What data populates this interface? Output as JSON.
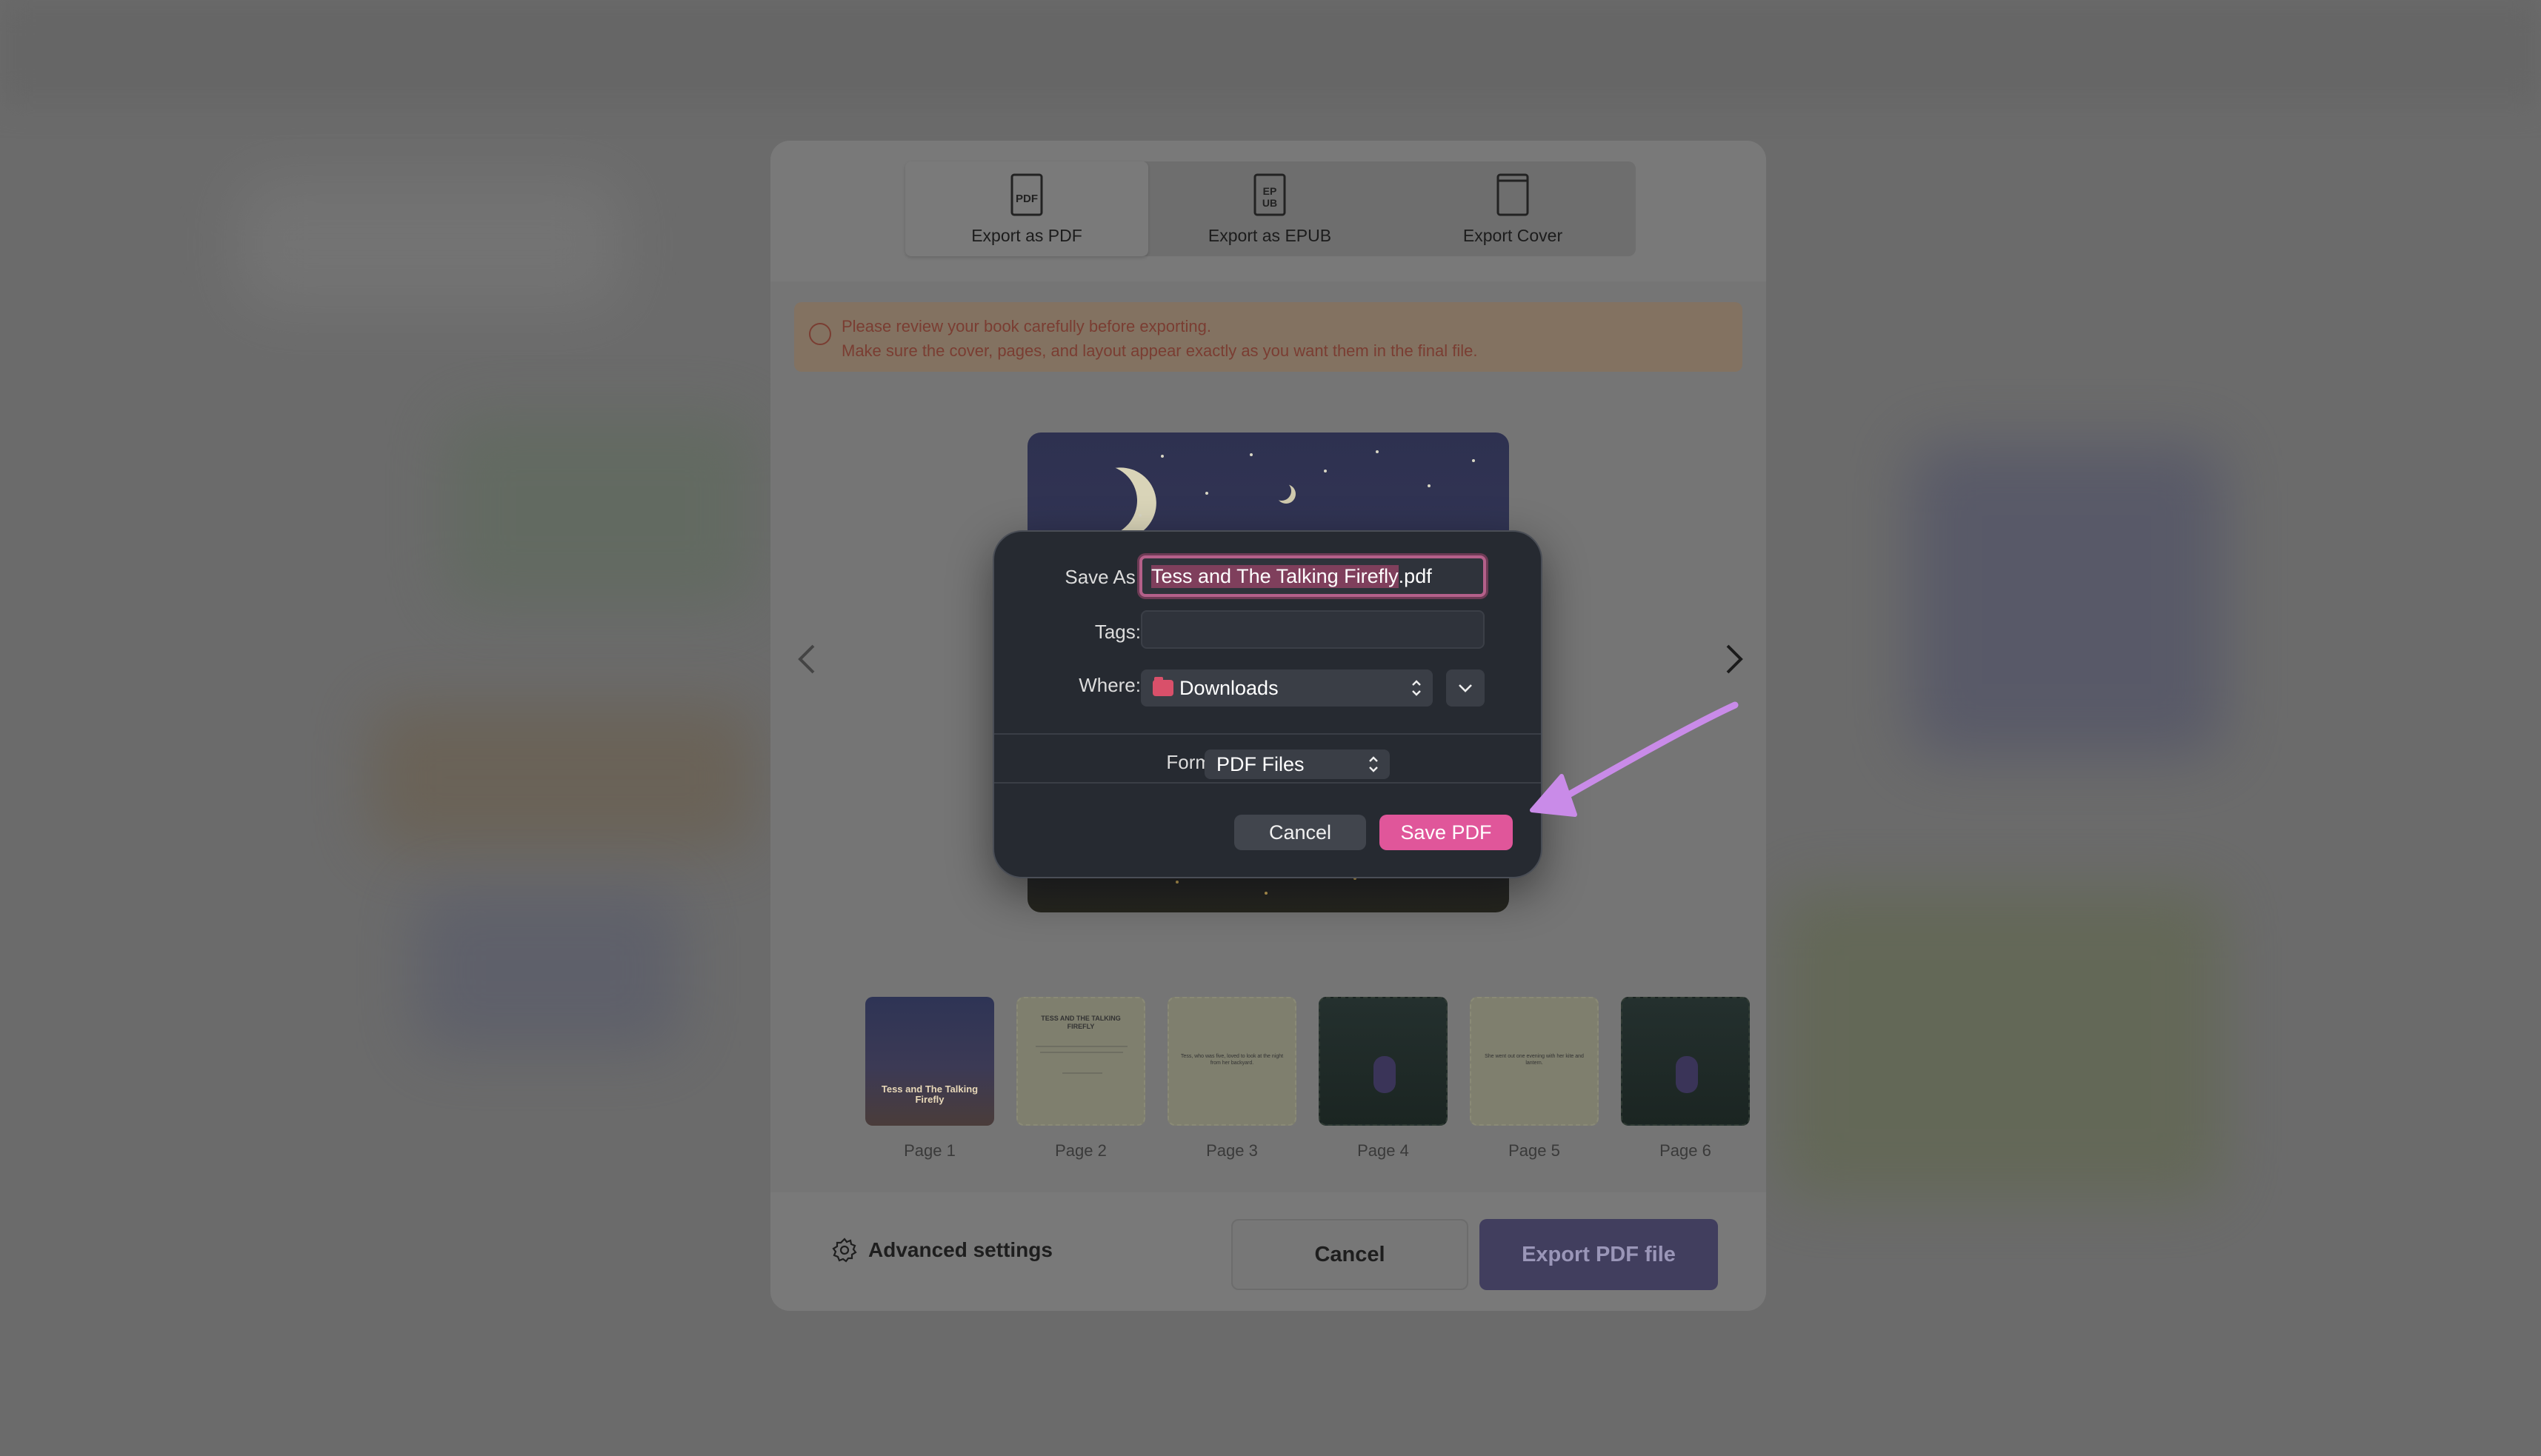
{
  "export_modal": {
    "tabs": [
      {
        "label": "Export as PDF",
        "icon": "pdf-file-icon",
        "icon_text": "PDF",
        "active": true
      },
      {
        "label": "Export as EPUB",
        "icon": "epub-file-icon",
        "icon_text": "EP UB",
        "active": false
      },
      {
        "label": "Export Cover",
        "icon": "cover-icon",
        "icon_text": "",
        "active": false
      }
    ],
    "notice": {
      "line1": "Please review your book carefully before exporting.",
      "line2": "Make sure the cover, pages, and layout appear exactly as you want them in the final file."
    },
    "thumbnails": [
      {
        "label": "Page 1",
        "title_text": "Tess and The Talking Firefly"
      },
      {
        "label": "Page 2",
        "title_text": "TESS AND THE TALKING FIREFLY"
      },
      {
        "label": "Page 3",
        "title_text": "Tess, who was five, loved to look at the night from her backyard."
      },
      {
        "label": "Page 4",
        "title_text": ""
      },
      {
        "label": "Page 5",
        "title_text": "She went out one evening with her kite and lantern."
      },
      {
        "label": "Page 6",
        "title_text": ""
      }
    ],
    "footer": {
      "advanced_settings": "Advanced settings",
      "cancel": "Cancel",
      "export": "Export PDF file"
    }
  },
  "save_sheet": {
    "save_as_label": "Save As:",
    "filename_selected": "Tess and The Talking Firefly",
    "filename_extension": ".pdf",
    "tags_label": "Tags:",
    "tags_value": "",
    "where_label": "Where:",
    "where_value": "Downloads",
    "format_label": "Format:",
    "format_value": "PDF Files",
    "cancel": "Cancel",
    "save": "Save PDF"
  },
  "colors": {
    "save_button": "#e0569a",
    "annotation_arrow": "#c98be8"
  }
}
